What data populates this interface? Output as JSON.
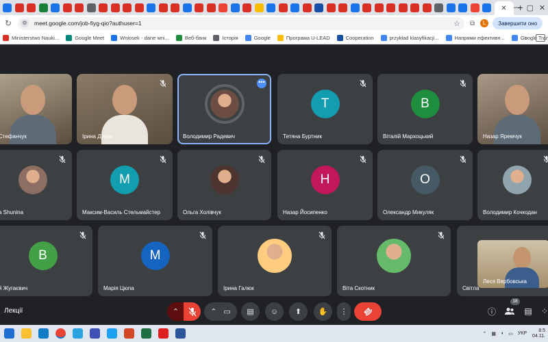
{
  "browser": {
    "tab_colors": [
      "#1a73e8",
      "#d93025",
      "#d93025",
      "#188038",
      "#1a73e8",
      "#d93025",
      "#d93025",
      "#5f6368",
      "#d93025",
      "#d93025",
      "#d93025",
      "#d93025",
      "#1a73e8",
      "#d93025",
      "#d93025",
      "#1a73e8",
      "#d93025",
      "#d93025",
      "#ea4335",
      "#1a73e8",
      "#d93025",
      "#fbbc04",
      "#1a73e8",
      "#d93025",
      "#1a73e8",
      "#d93025",
      "#174ea6",
      "#d93025",
      "#d93025",
      "#1a73e8",
      "#d93025",
      "#d93025",
      "#d93025",
      "#d93025",
      "#d93025",
      "#d93025",
      "#5f6368",
      "#1a73e8",
      "#1a73e8",
      "#ea4335",
      "#1a73e8"
    ],
    "active_tab_close": "✕",
    "new_tab": "+",
    "window_controls": [
      "—",
      "▢",
      "✕"
    ],
    "url": "meet.google.com/job-fiyg-qio?authuser=1",
    "profile_initial": "L",
    "update_button": "Завершити оно"
  },
  "bookmarks": [
    {
      "label": "Ministerstwo Nauki...",
      "color": "#d93025"
    },
    {
      "label": "Google Meet",
      "color": "#00897b"
    },
    {
      "label": "Wniosek - dane wni...",
      "color": "#1a73e8"
    },
    {
      "label": "Веб-банк",
      "color": "#1e8e3e"
    },
    {
      "label": "Історія",
      "color": "#5f6368"
    },
    {
      "label": "Google",
      "color": "#4285f4"
    },
    {
      "label": "Програма U-LEAD",
      "color": "#fbbc04"
    },
    {
      "label": "Cooperation",
      "color": "#174ea6"
    },
    {
      "label": "przykład klasyfikacji...",
      "color": "#4285f4"
    },
    {
      "label": "Напрями ефективн...",
      "color": "#4285f4"
    },
    {
      "label": "Google Translate",
      "color": "#4285f4"
    }
  ],
  "bookmarks_more": "»",
  "meet": {
    "tiles": [
      {
        "name": "Стефанчук",
        "kind": "video",
        "muted": false
      },
      {
        "name": "Ірина Дутка",
        "kind": "video",
        "muted": true
      },
      {
        "name": "Володимир Радевич",
        "kind": "photo",
        "speaking": true,
        "more": "•••"
      },
      {
        "name": "Тетяна Буртник",
        "kind": "letter",
        "letter": "Т",
        "color": "#129eaf",
        "muted": true
      },
      {
        "name": "Віталій Мархоцький",
        "kind": "letter",
        "letter": "В",
        "color": "#1e8e3e",
        "muted": true
      },
      {
        "name": "Назар Яремчук",
        "kind": "video",
        "muted": false
      },
      {
        "name": "a Shunina",
        "kind": "photo",
        "muted": true
      },
      {
        "name": "Максим-Василь Стельмайстер",
        "kind": "letter",
        "letter": "М",
        "color": "#129eaf",
        "muted": true
      },
      {
        "name": "Ольга Холівчук",
        "kind": "photo",
        "muted": true
      },
      {
        "name": "Назар Йосипенко",
        "kind": "letter",
        "letter": "Н",
        "color": "#c2185b",
        "muted": true
      },
      {
        "name": "Олександр Микуляк",
        "kind": "letter",
        "letter": "О",
        "color": "#455a64",
        "muted": true
      },
      {
        "name": "Володимир Кочкодан",
        "kind": "photo",
        "muted": true
      },
      {
        "name": "й Жугаєвич",
        "kind": "letter",
        "letter": "В",
        "color": "#43a047",
        "muted": true
      },
      {
        "name": "Марія Цюпа",
        "kind": "letter",
        "letter": "М",
        "color": "#1565c0",
        "muted": true
      },
      {
        "name": "Ірина Галюк",
        "kind": "photo",
        "muted": true
      },
      {
        "name": "Віта Скотник",
        "kind": "photo",
        "muted": true
      },
      {
        "name": "Світла",
        "kind": "blank",
        "muted": false
      }
    ],
    "self_view_name": "Леся Вербовська"
  },
  "controls": {
    "meeting_name": "Лекції",
    "participant_count": "18",
    "icons": {
      "mic_options": "⌃",
      "mic": "mic-off",
      "cam_options": "⌃",
      "camera": "▭",
      "captions": "▤",
      "emoji": "☺",
      "present": "⬆",
      "hand": "✋",
      "more": "⋮",
      "end": "☎",
      "info": "ⓘ",
      "people": "👥",
      "chat": "▤",
      "activities": "⁘"
    }
  },
  "taskbar": {
    "apps": [
      {
        "name": "file-explorer",
        "color": "#fbc02d"
      },
      {
        "name": "edge",
        "color": "#0f7cc5"
      },
      {
        "name": "chrome",
        "color": "#ea4335"
      },
      {
        "name": "teams",
        "color": "#2aa4e0"
      },
      {
        "name": "save-app",
        "color": "#3f51b5"
      },
      {
        "name": "chrome-alt",
        "color": "#1da1f2"
      },
      {
        "name": "powerpoint",
        "color": "#d24726"
      },
      {
        "name": "excel",
        "color": "#1d6f42"
      },
      {
        "name": "acrobat",
        "color": "#e02020"
      },
      {
        "name": "word",
        "color": "#2b579a"
      }
    ],
    "tray_up": "⌃",
    "lang": "УКР",
    "time": "8:5",
    "date": "04.11."
  }
}
